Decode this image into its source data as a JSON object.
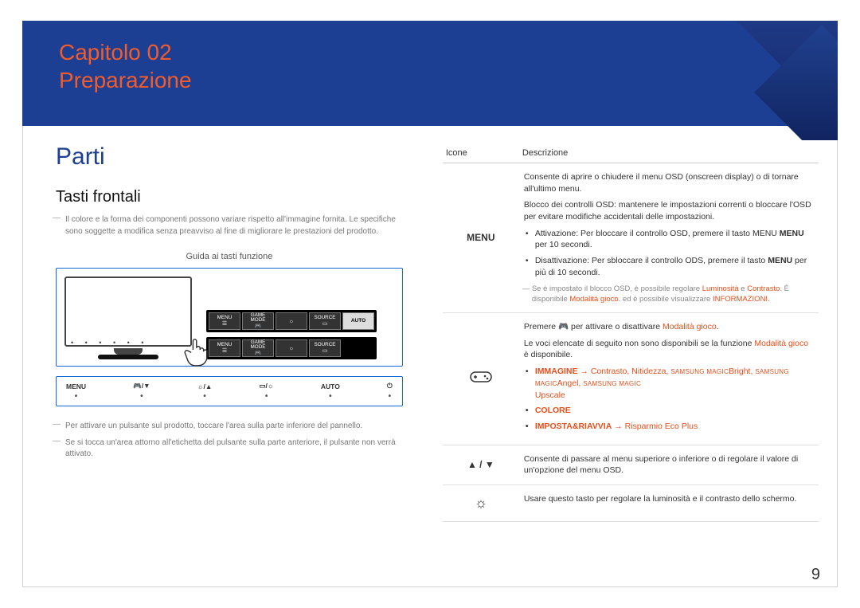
{
  "banner": {
    "chapter": "Capitolo 02",
    "title": "Preparazione"
  },
  "left": {
    "section": "Parti",
    "subsection": "Tasti frontali",
    "note1": "Il colore e la forma dei componenti possono variare rispetto all'immagine fornita. Le specifiche sono soggette a modifica senza preavviso al fine di migliorare le prestazioni del prodotto.",
    "guide_label": "Guida ai tasti funzione",
    "osd": {
      "menu": "MENU",
      "game1": "GAME",
      "game2": "MODE",
      "source": "SOURCE",
      "auto": "AUTO"
    },
    "button_labels": {
      "menu": "MENU",
      "gamepad_arrows": "🎮/▼",
      "sun_arrows": "☼/▲",
      "rect_sun": "▭/☼",
      "auto": "AUTO",
      "power": "⏻"
    },
    "note2": "Per attivare un pulsante sul prodotto, toccare l'area sulla parte inferiore del pannello.",
    "note3": "Se si tocca un'area attorno all'etichetta del pulsante sulla parte anteriore, il pulsante non verrà attivato."
  },
  "table": {
    "head_icon": "Icone",
    "head_desc": "Descrizione",
    "row_menu": {
      "icon": "MENU",
      "opening": "Consente di aprire o chiudere il menu OSD (onscreen display) o di tornare all'ultimo menu.",
      "lock_desc": "Blocco dei controlli OSD: mantenere le impostazioni correnti o bloccare l'OSD per evitare modifiche accidentali delle impostazioni.",
      "act_prefix": "Attivazione: Per bloccare il controllo OSD, premere il tasto MENU ",
      "act_bold": "MENU",
      "act_suffix": " per 10 secondi.",
      "deact_prefix": "Disattivazione: Per sbloccare il controllo ODS, premere il tasto ",
      "deact_bold": "MENU",
      "deact_suffix": " per più di 10 secondi.",
      "small_prefix": "Se è impostato il blocco OSD, è possibile regolare ",
      "small_lum": "Luminosità",
      "small_and": " e ",
      "small_con": "Contrasto",
      "small_mid": ". È disponibile ",
      "small_mg": "Modalità gioco",
      "small_tail": ". ed è possibile visualizzare ",
      "small_info": "INFORMAZIONI",
      "small_period": "."
    },
    "row_game": {
      "premere_prefix": "Premere 🎮 per attivare o disattivare ",
      "premere_mg": "Modalità gioco",
      "premere_suffix": ".",
      "voci_prefix": "Le voci elencate di seguito non sono disponibili se la funzione ",
      "voci_mg": "Modalità gioco",
      "voci_suffix": " è disponibile.",
      "li1_immagine": "IMMAGINE",
      "li1_arrow": " → ",
      "li1_contrasto": "Contrasto",
      "li1_comma1": ", ",
      "li1_nitidezza": "Nitidezza",
      "li1_comma2": ", ",
      "li1_sams_small1": "SAMSUNG MAGIC",
      "li1_bright": "Bright",
      "li1_comma3": ", ",
      "li1_sams_small2": "SAMSUNG MAGIC",
      "li1_angel": "Angel",
      "li1_comma4": ", ",
      "li1_sams_small3": "SAMSUNG MAGIC",
      "li1_upscale": "Upscale",
      "li2_colore": "COLORE",
      "li3_imposta": "IMPOSTA&RIAVVIA",
      "li3_arrow": " → ",
      "li3_eco": "Risparmio Eco Plus"
    },
    "row_arrows": {
      "icon": "▲ / ▼",
      "desc": "Consente di passare al menu superiore o inferiore o di regolare il valore di un'opzione del menu OSD."
    },
    "row_sun": {
      "icon": "☼",
      "desc": "Usare questo tasto per regolare la luminosità e il contrasto dello schermo."
    }
  },
  "page_number": "9"
}
